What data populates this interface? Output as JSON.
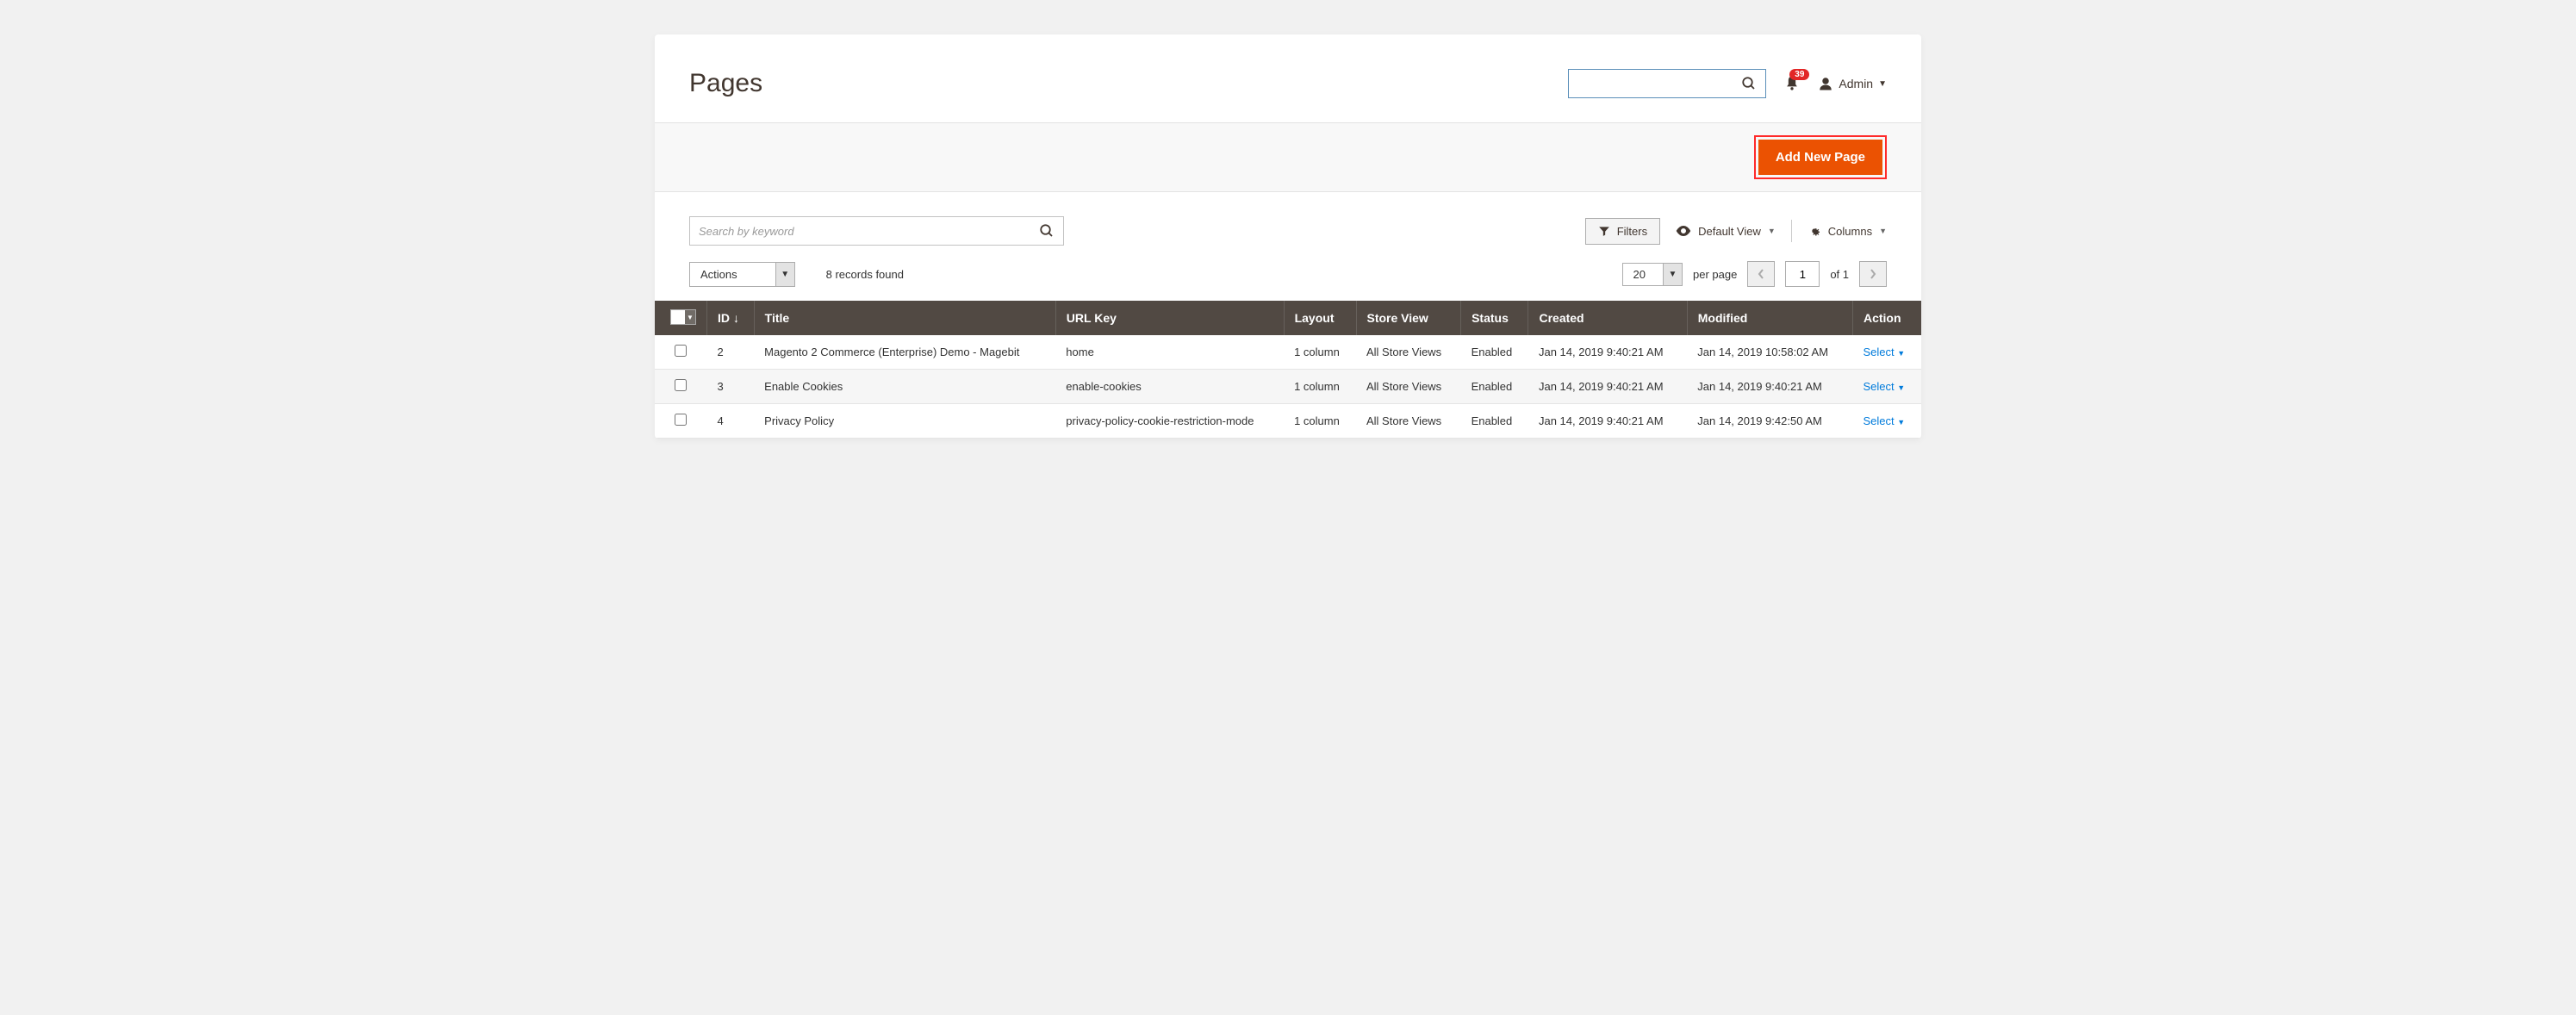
{
  "header": {
    "title": "Pages",
    "search_placeholder": "",
    "notif_count": "39",
    "admin_label": "Admin"
  },
  "actions": {
    "add_new_page": "Add New Page"
  },
  "toolbar": {
    "search_placeholder": "Search by keyword",
    "filters": "Filters",
    "default_view": "Default View",
    "columns": "Columns"
  },
  "meta": {
    "actions_dd": "Actions",
    "records_found": "8 records found",
    "page_size": "20",
    "per_page": "per page",
    "current_page": "1",
    "of_label": "of 1"
  },
  "table": {
    "headers": {
      "id": "ID",
      "title": "Title",
      "url_key": "URL Key",
      "layout": "Layout",
      "store_view": "Store View",
      "status": "Status",
      "created": "Created",
      "modified": "Modified",
      "action": "Action"
    },
    "rows": [
      {
        "id": "2",
        "title": "Magento 2 Commerce (Enterprise) Demo - Magebit",
        "url_key": "home",
        "layout": "1 column",
        "store_view": "All Store Views",
        "status": "Enabled",
        "created": "Jan 14, 2019 9:40:21 AM",
        "modified": "Jan 14, 2019 10:58:02 AM",
        "action": "Select"
      },
      {
        "id": "3",
        "title": "Enable Cookies",
        "url_key": "enable-cookies",
        "layout": "1 column",
        "store_view": "All Store Views",
        "status": "Enabled",
        "created": "Jan 14, 2019 9:40:21 AM",
        "modified": "Jan 14, 2019 9:40:21 AM",
        "action": "Select"
      },
      {
        "id": "4",
        "title": "Privacy Policy",
        "url_key": "privacy-policy-cookie-restriction-mode",
        "layout": "1 column",
        "store_view": "All Store Views",
        "status": "Enabled",
        "created": "Jan 14, 2019 9:40:21 AM",
        "modified": "Jan 14, 2019 9:42:50 AM",
        "action": "Select"
      }
    ]
  }
}
